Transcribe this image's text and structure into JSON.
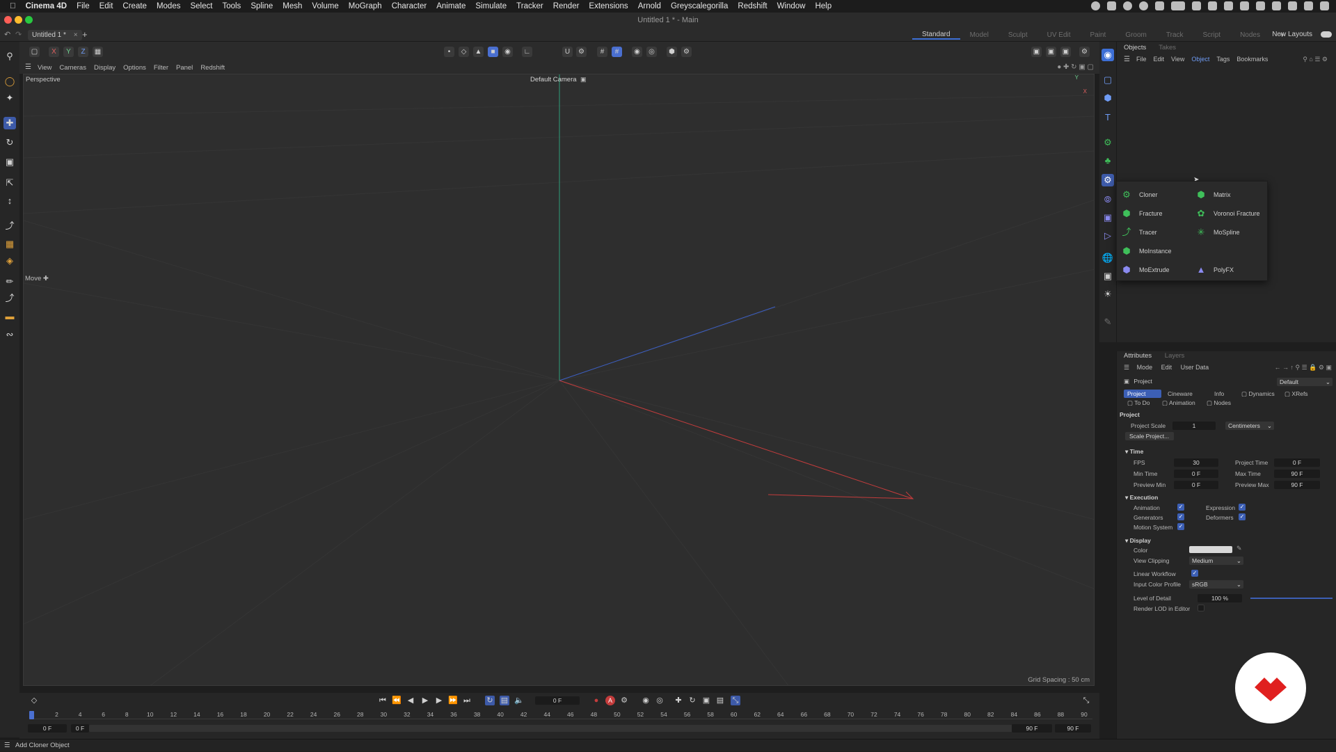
{
  "menubar": {
    "app": "Cinema 4D",
    "items": [
      "File",
      "Edit",
      "Create",
      "Modes",
      "Select",
      "Tools",
      "Spline",
      "Mesh",
      "Volume",
      "MoGraph",
      "Character",
      "Animate",
      "Simulate",
      "Tracker",
      "Render",
      "Extensions",
      "Arnold",
      "Greyscalegorilla",
      "Redshift",
      "Window",
      "Help"
    ]
  },
  "window": {
    "title": "Untitled 1 * - Main"
  },
  "tabs": {
    "document": "Untitled 1 *",
    "close": "×",
    "add": "+"
  },
  "layout_tabs": [
    "Standard",
    "Model",
    "Sculpt",
    "UV Edit",
    "Paint",
    "Groom",
    "Track",
    "Script",
    "Nodes"
  ],
  "layout_active": "Standard",
  "new_layouts": "New Layouts",
  "axis_buttons": {
    "x": "X",
    "y": "Y",
    "z": "Z"
  },
  "viewport": {
    "menu": [
      "View",
      "Cameras",
      "Display",
      "Options",
      "Filter",
      "Panel",
      "Redshift"
    ],
    "label": "Perspective",
    "camera": "Default Camera",
    "grid_spacing": "Grid Spacing : 50 cm",
    "move_hint": "Move",
    "gizmo_y": "Y",
    "gizmo_x": "X"
  },
  "objects_panel": {
    "tabs": [
      "Objects",
      "Takes"
    ],
    "menu": [
      "File",
      "Edit",
      "View",
      "Object",
      "Tags",
      "Bookmarks"
    ],
    "menu_selected": "Object"
  },
  "mograph_popup": {
    "left": [
      {
        "label": "Cloner",
        "icon": "cloner-icon"
      },
      {
        "label": "Fracture",
        "icon": "fracture-icon"
      },
      {
        "label": "Tracer",
        "icon": "tracer-icon"
      },
      {
        "label": "MoInstance",
        "icon": "moinstance-icon"
      },
      {
        "label": "MoExtrude",
        "icon": "moextrude-icon"
      }
    ],
    "right": [
      {
        "label": "Matrix",
        "icon": "matrix-icon"
      },
      {
        "label": "Voronoi Fracture",
        "icon": "voronoi-fracture-icon"
      },
      {
        "label": "MoSpline",
        "icon": "mospline-icon"
      },
      {
        "label": "PolyFX",
        "icon": "polyfx-icon"
      }
    ]
  },
  "attributes": {
    "tabs": [
      "Attributes",
      "Layers"
    ],
    "menu": [
      "Mode",
      "Edit",
      "User Data"
    ],
    "object": "Project",
    "preset": "Default",
    "subtabs_row1": [
      "Project",
      "Cineware",
      "Info",
      "Dynamics",
      "XRefs"
    ],
    "subtabs_row2": [
      "To Do",
      "Animation",
      "Nodes"
    ],
    "section_project": "Project",
    "project_scale_label": "Project Scale",
    "project_scale_value": "1",
    "project_scale_unit": "Centimeters",
    "scale_project_button": "Scale Project...",
    "time": {
      "title": "Time",
      "fps_label": "FPS",
      "fps": "30",
      "project_time_label": "Project Time",
      "project_time": "0 F",
      "min_time_label": "Min Time",
      "min_time": "0 F",
      "max_time_label": "Max Time",
      "max_time": "90 F",
      "preview_min_label": "Preview Min",
      "preview_min": "0 F",
      "preview_max_label": "Preview Max",
      "preview_max": "90 F"
    },
    "execution": {
      "title": "Execution",
      "animation": "Animation",
      "expression": "Expression",
      "generators": "Generators",
      "deformers": "Deformers",
      "motion_system": "Motion System"
    },
    "display": {
      "title": "Display",
      "color_label": "Color",
      "view_clipping_label": "View Clipping",
      "view_clipping": "Medium",
      "linear_workflow_label": "Linear Workflow",
      "input_color_profile_label": "Input Color Profile",
      "input_color_profile": "sRGB",
      "lod_label": "Level of Detail",
      "lod": "100 %",
      "lod_level": 1.0,
      "render_lod_label": "Render LOD in Editor"
    }
  },
  "timeline": {
    "current_frame": "0 F",
    "ticks": [
      "0",
      "2",
      "4",
      "6",
      "8",
      "10",
      "12",
      "14",
      "16",
      "18",
      "20",
      "22",
      "24",
      "26",
      "28",
      "30",
      "32",
      "34",
      "36",
      "38",
      "40",
      "42",
      "44",
      "46",
      "48",
      "50",
      "52",
      "54",
      "56",
      "58",
      "60",
      "62",
      "64",
      "66",
      "68",
      "70",
      "72",
      "74",
      "76",
      "78",
      "80",
      "82",
      "84",
      "86",
      "88",
      "90"
    ],
    "start_a": "0 F",
    "start_b": "0 F",
    "end_a": "90 F",
    "end_b": "90 F"
  },
  "status": {
    "text": "Add Cloner Object"
  },
  "colors": {
    "accent": "#3d6fd6",
    "mograph_green": "#3fbf5a",
    "axis_x": "#c43c3c",
    "axis_y": "#3fbf8f",
    "axis_z": "#3c5fc4",
    "logo_red": "#e0201f"
  }
}
